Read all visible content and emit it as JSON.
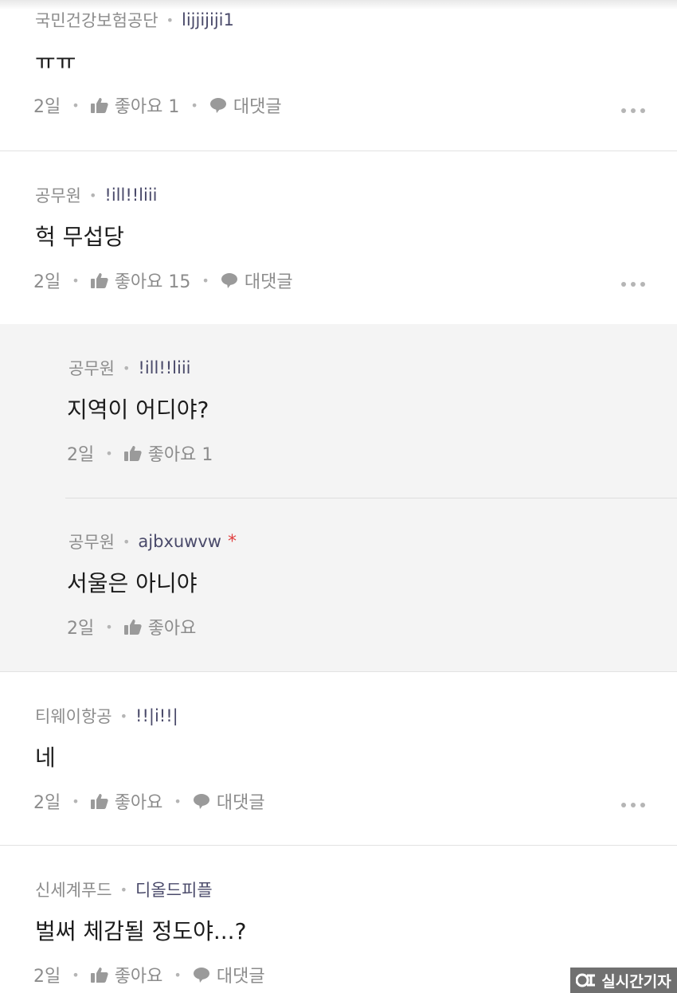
{
  "comments": [
    {
      "author": "국민건강보험공단",
      "nickname": "lijjijiji1",
      "text": "ㅠㅠ",
      "time": "2일",
      "like_label": "좋아요 1",
      "reply_label": "대댓글"
    },
    {
      "author": "공무원",
      "nickname": "!ill!!liii",
      "text": "헉 무섭당",
      "time": "2일",
      "like_label": "좋아요 15",
      "reply_label": "대댓글"
    },
    {
      "author": "티웨이항공",
      "nickname": "!!|i!!|",
      "text": "네",
      "time": "2일",
      "like_label": "좋아요",
      "reply_label": "대댓글"
    },
    {
      "author": "신세계푸드",
      "nickname": "디올드피플",
      "text": "벌써 체감될 정도야...?",
      "time": "2일",
      "like_label": "좋아요",
      "reply_label": "대댓글"
    }
  ],
  "replies": [
    {
      "author": "공무원",
      "nickname": "!ill!!liii",
      "text": "지역이 어디야?",
      "time": "2일",
      "like_label": "좋아요 1"
    },
    {
      "author": "공무원",
      "nickname": "ajbxuwvw",
      "author_mark": "*",
      "text": "서울은 아니야",
      "time": "2일",
      "like_label": "좋아요"
    }
  ],
  "watermark": {
    "text": "실시간기자"
  },
  "colors": {
    "meta": "#8c8c8c",
    "reply_bg": "#f4f4f4",
    "author_mark": "#e03e3e"
  },
  "icons": {
    "like": "thumbs-up-icon",
    "reply": "speech-bubble-icon",
    "more": "more-dots-icon"
  }
}
